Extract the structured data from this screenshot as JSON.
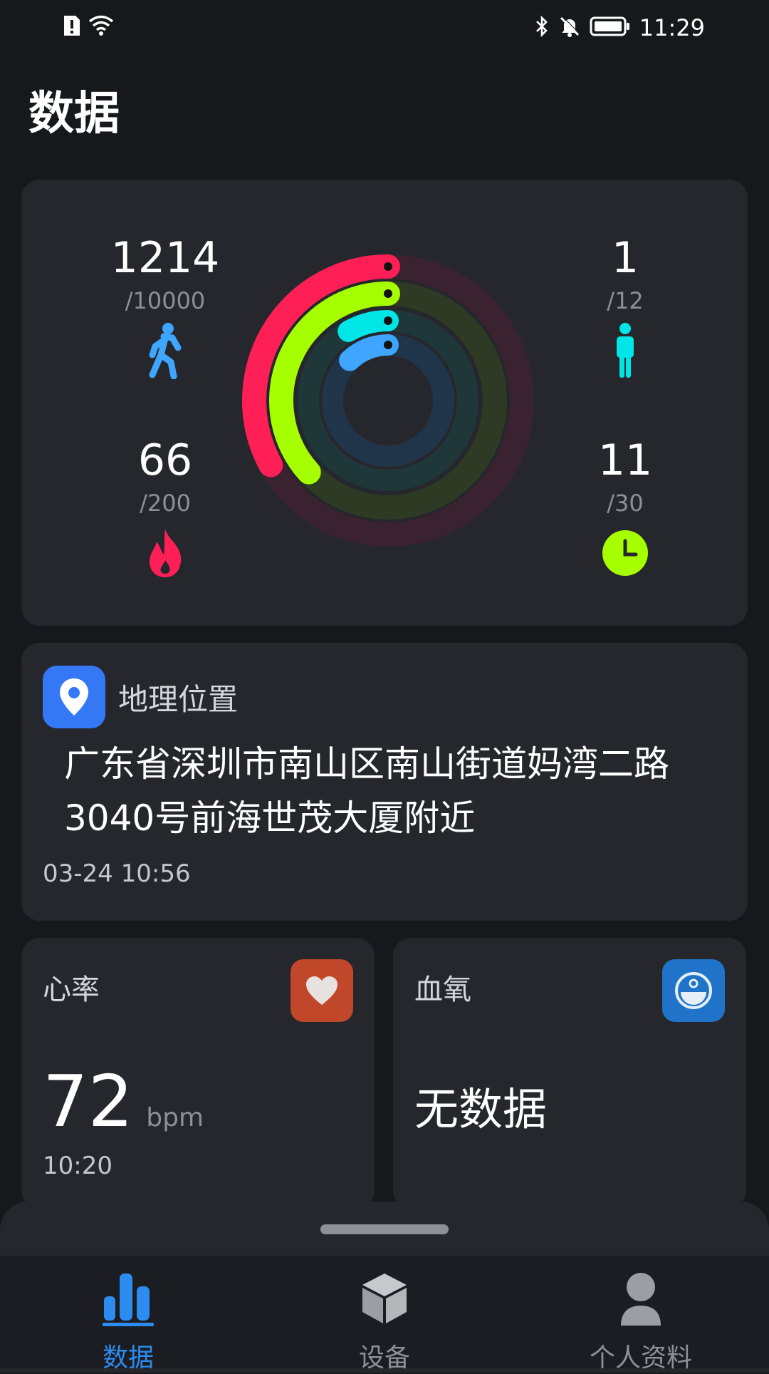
{
  "status_bar": {
    "time": "11:29"
  },
  "page_title": "数据",
  "activity": {
    "steps": {
      "value": "1214",
      "goal": "/10000",
      "progress": 0.1214,
      "color": "#3ea6ff"
    },
    "calories": {
      "value": "66",
      "goal": "/200",
      "progress": 0.33,
      "color": "#ff1f57"
    },
    "standing": {
      "value": "1",
      "goal": "/12",
      "progress": 0.083,
      "color": "#00e5e5"
    },
    "exercise": {
      "value": "11",
      "goal": "/30",
      "progress": 0.367,
      "color": "#a6ff00"
    }
  },
  "location": {
    "title": "地理位置",
    "address": "广东省深圳市南山区南山街道妈湾二路3040号前海世茂大厦附近",
    "time": "03-24 10:56"
  },
  "heart_rate": {
    "title": "心率",
    "value": "72",
    "unit": "bpm",
    "time": "10:20",
    "icon_color": "#c0472a"
  },
  "blood_oxygen": {
    "title": "血氧",
    "value": "无数据",
    "icon_color": "#1f74c9"
  },
  "nav": [
    {
      "label": "数据",
      "icon": "bar-chart-icon",
      "active": true
    },
    {
      "label": "设备",
      "icon": "cube-icon",
      "active": false
    },
    {
      "label": "个人资料",
      "icon": "person-icon",
      "active": false
    }
  ]
}
